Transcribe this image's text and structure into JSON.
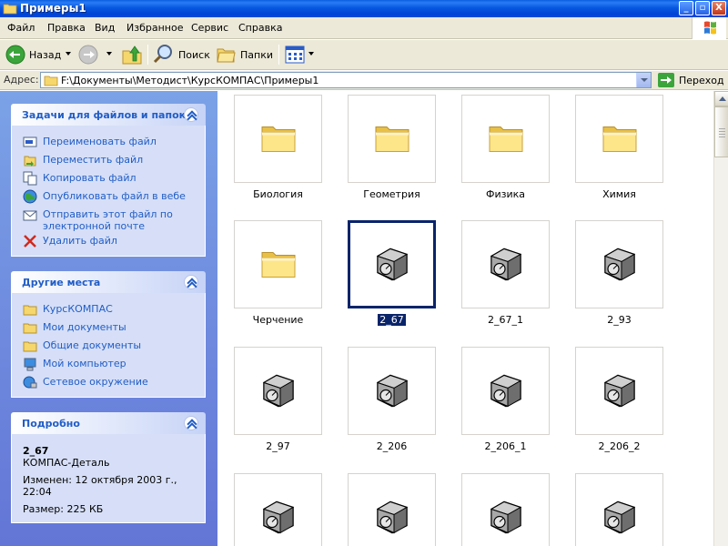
{
  "window": {
    "title": "Примеры1",
    "buttons": [
      "_",
      "▫",
      "X"
    ]
  },
  "menubar": {
    "items": [
      "Файл",
      "Правка",
      "Вид",
      "Избранное",
      "Сервис",
      "Справка"
    ]
  },
  "toolbar": {
    "back_label": "Назад",
    "search_label": "Поиск",
    "folders_label": "Папки"
  },
  "address": {
    "label": "Адрес:",
    "path": "F:\\Документы\\Методист\\КурсКОМПАС\\Примеры1",
    "go_label": "Переход"
  },
  "tasks_panel": {
    "title": "Задачи для файлов и папок",
    "items": [
      {
        "label": "Переименовать файл",
        "icon": "rename-icon"
      },
      {
        "label": "Переместить файл",
        "icon": "move-icon"
      },
      {
        "label": "Копировать файл",
        "icon": "copy-icon"
      },
      {
        "label": "Опубликовать файл в вебе",
        "icon": "publish-web-icon"
      },
      {
        "label": "Отправить этот файл по электронной почте",
        "icon": "email-icon"
      },
      {
        "label": "Удалить файл",
        "icon": "delete-icon"
      }
    ]
  },
  "places_panel": {
    "title": "Другие места",
    "items": [
      {
        "label": "КурсКОМПАС",
        "icon": "folder-icon"
      },
      {
        "label": "Мои документы",
        "icon": "folder-icon"
      },
      {
        "label": "Общие документы",
        "icon": "folder-icon"
      },
      {
        "label": "Мой компьютер",
        "icon": "computer-icon"
      },
      {
        "label": "Сетевое окружение",
        "icon": "network-icon"
      }
    ]
  },
  "details_panel": {
    "title": "Подробно",
    "name": "2_67",
    "type": "КОМПАС-Деталь",
    "modified": "Изменен: 12 октября 2003 г., 22:04",
    "size": "Размер: 225 КБ"
  },
  "files": [
    {
      "name": "Биология",
      "kind": "folder"
    },
    {
      "name": "Геометрия",
      "kind": "folder"
    },
    {
      "name": "Физика",
      "kind": "folder"
    },
    {
      "name": "Химия",
      "kind": "folder"
    },
    {
      "name": "Черчение",
      "kind": "folder"
    },
    {
      "name": "2_67",
      "kind": "part",
      "selected": true
    },
    {
      "name": "2_67_1",
      "kind": "part"
    },
    {
      "name": "2_93",
      "kind": "part"
    },
    {
      "name": "2_97",
      "kind": "part"
    },
    {
      "name": "2_206",
      "kind": "part"
    },
    {
      "name": "2_206_1",
      "kind": "part"
    },
    {
      "name": "2_206_2",
      "kind": "part"
    },
    {
      "name": "",
      "kind": "part"
    },
    {
      "name": "",
      "kind": "part"
    },
    {
      "name": "",
      "kind": "part"
    },
    {
      "name": "",
      "kind": "part"
    }
  ],
  "colors": {
    "title_bar": "#0054e3",
    "task_link": "#215dc6",
    "selection": "#0a246a",
    "panel_bg": "#d6dff7"
  }
}
